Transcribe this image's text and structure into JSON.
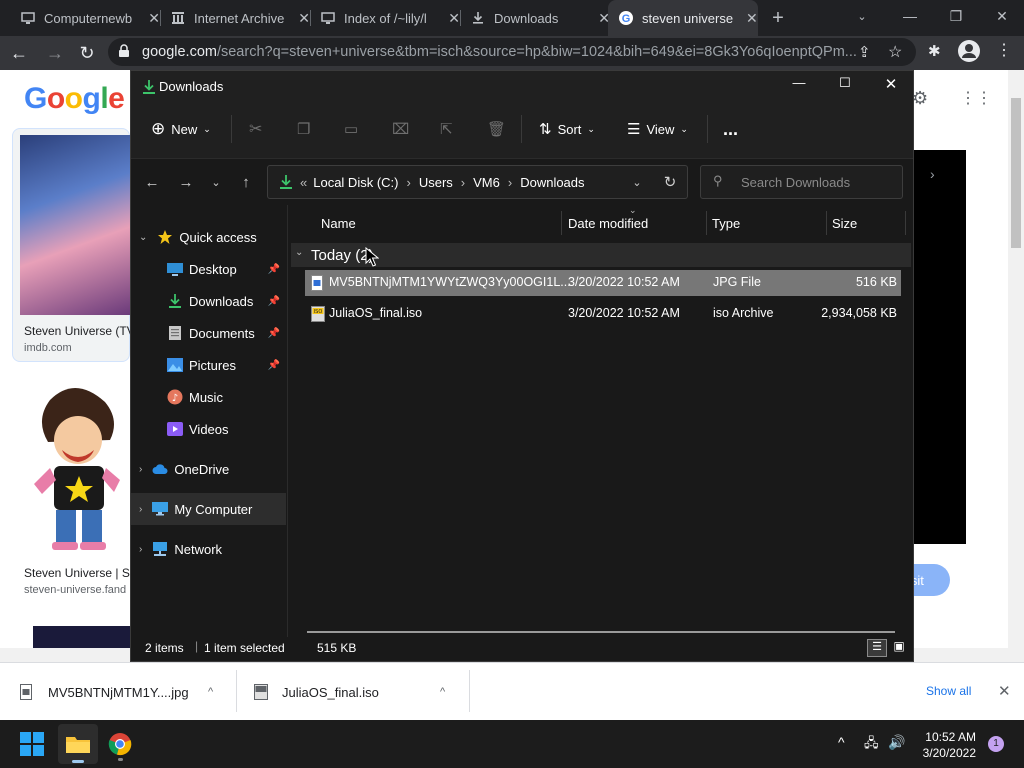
{
  "browser": {
    "tabs": [
      {
        "title": "Computernewb",
        "icon": "vm-icon"
      },
      {
        "title": "Internet Archive",
        "icon": "archive-icon"
      },
      {
        "title": "Index of /~lily/l",
        "icon": "vm-icon"
      },
      {
        "title": "Downloads",
        "icon": "download-icon"
      },
      {
        "title": "steven universe",
        "icon": "google-icon",
        "active": true
      }
    ],
    "address_host": "google.com",
    "address_rest": "/search?q=steven+universe&tbm=isch&source=hp&biw=1024&bih=649&ei=8Gk3Yo6qIoenptQPm..."
  },
  "google_page": {
    "logo": "Google",
    "results": [
      {
        "title": "Steven Universe (TV",
        "source": "imdb.com"
      },
      {
        "title": "Steven Universe | St",
        "source": "steven-universe.fand"
      }
    ],
    "visit_label": "isit"
  },
  "explorer": {
    "title": "Downloads",
    "commands": {
      "new": "New",
      "sort": "Sort",
      "view": "View",
      "more": "..."
    },
    "breadcrumb": [
      "Local Disk (C:)",
      "Users",
      "VM6",
      "Downloads"
    ],
    "breadcrumb_overflow": "«",
    "search_placeholder": "Search Downloads",
    "sidebar": [
      {
        "label": "Quick access",
        "icon": "star-icon",
        "color": "#f5c518"
      },
      {
        "label": "Desktop",
        "icon": "desktop-icon",
        "pinned": true
      },
      {
        "label": "Downloads",
        "icon": "download-icon",
        "pinned": true
      },
      {
        "label": "Documents",
        "icon": "documents-icon",
        "pinned": true
      },
      {
        "label": "Pictures",
        "icon": "pictures-icon",
        "pinned": true
      },
      {
        "label": "Music",
        "icon": "music-icon"
      },
      {
        "label": "Videos",
        "icon": "videos-icon"
      },
      {
        "label": "OneDrive",
        "icon": "cloud-icon"
      },
      {
        "label": "My Computer",
        "icon": "computer-icon",
        "selected": true
      },
      {
        "label": "Network",
        "icon": "network-icon"
      }
    ],
    "columns": [
      "Name",
      "Date modified",
      "Type",
      "Size"
    ],
    "group_label": "Today (2)",
    "files": [
      {
        "name": "MV5BNTNjMTM1YWYtZWQ3Yy00OGI1L...",
        "date": "3/20/2022 10:52 AM",
        "type": "JPG File",
        "size": "516 KB",
        "selected": true
      },
      {
        "name": "JuliaOS_final.iso",
        "date": "3/20/2022 10:52 AM",
        "type": "iso Archive",
        "size": "2,934,058 KB"
      }
    ],
    "status": {
      "items": "2 items",
      "selected": "1 item selected",
      "size": "515 KB"
    }
  },
  "downloads_shelf": {
    "items": [
      {
        "name": "MV5BNTNjMTM1Y....jpg"
      },
      {
        "name": "JuliaOS_final.iso"
      }
    ],
    "show_all": "Show all"
  },
  "taskbar": {
    "time": "10:52 AM",
    "date": "3/20/2022",
    "notification_count": "1"
  },
  "colors": {
    "accent": "#8ab4f8",
    "selection": "#777777",
    "download_green": "#3cc46a"
  }
}
